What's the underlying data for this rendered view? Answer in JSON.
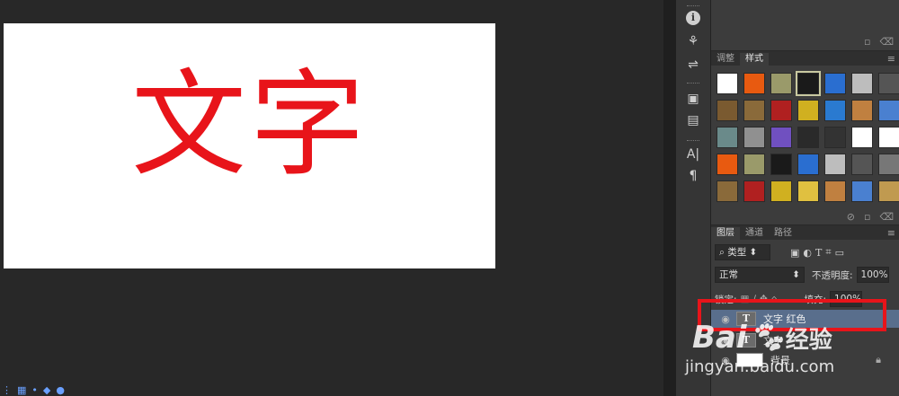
{
  "canvas": {
    "text": "文字",
    "text_color": "#e8141a",
    "background": "#ffffff"
  },
  "taskbar": {
    "icons": [
      "network-icon",
      "keyboard-icon",
      "settings-icon",
      "shield-icon",
      "app-icon"
    ]
  },
  "toolstrip": {
    "tools": [
      "info-icon",
      "brush-icon",
      "adjust-icon",
      "layers-icon",
      "document-icon",
      "character-icon",
      "paragraph-icon"
    ]
  },
  "styles_panel": {
    "tabs": [
      "调整",
      "样式"
    ],
    "active_tab": "样式",
    "swatches": [
      "#ffffff",
      "#e85a10",
      "#9a9a6a",
      "#1a1a1a",
      "#2a6ed0",
      "#bdbdbd",
      "#555555",
      "#7a5a30",
      "#8a6a3a",
      "#b02020",
      "#d0b020",
      "#2a7ad0",
      "#c08040",
      "#4a80d0",
      "#6a8a8a",
      "#909090",
      "#7050c0",
      "#2a2a2a",
      "#333333",
      "#ffffff",
      "#ffffff",
      "#e85a10",
      "#9a9a6a",
      "#1a1a1a",
      "#2a6ed0",
      "#bdbdbd",
      "#555555",
      "#777777",
      "#8a6a3a",
      "#b02020",
      "#d0b020",
      "#e0c040",
      "#c08040",
      "#4a80d0",
      "#c09a50"
    ],
    "footer_icons": [
      "new-style-icon",
      "delete-icon"
    ]
  },
  "layers_panel": {
    "tabs": [
      "图层",
      "通道",
      "路径"
    ],
    "active_tab": "图层",
    "filter_label": "类型",
    "blend_mode": "正常",
    "opacity_label": "不透明度:",
    "opacity_value": "100%",
    "lock_label": "锁定:",
    "fill_label": "填充:",
    "fill_value": "100%",
    "layers": [
      {
        "name": "文字 红色",
        "type": "text"
      },
      {
        "name": "文字",
        "type": "text"
      },
      {
        "name": "背景",
        "type": "image"
      }
    ]
  },
  "watermark": {
    "brand": "Bai",
    "brand_cn": "经验",
    "url": "jingyan.baidu.com"
  },
  "highlight_color": "#e8141a"
}
